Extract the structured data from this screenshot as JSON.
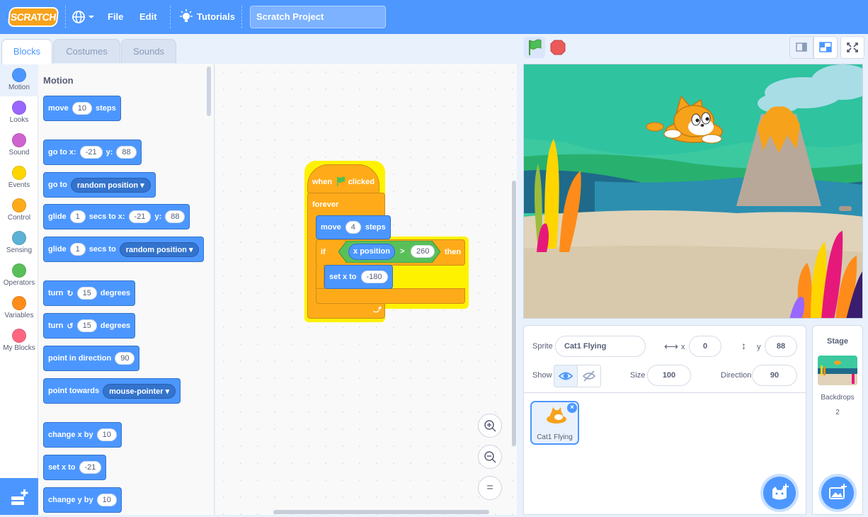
{
  "menubar": {
    "logo": "SCRATCH",
    "file": "File",
    "edit": "Edit",
    "tutorials": "Tutorials",
    "project_title": "Scratch Project"
  },
  "tabs": {
    "code": "Blocks",
    "costumes": "Costumes",
    "sounds": "Sounds"
  },
  "categories": [
    {
      "label": "Motion",
      "color": "#4c97ff"
    },
    {
      "label": "Looks",
      "color": "#9966ff"
    },
    {
      "label": "Sound",
      "color": "#cf63cf"
    },
    {
      "label": "Events",
      "color": "#ffd500"
    },
    {
      "label": "Control",
      "color": "#ffab19"
    },
    {
      "label": "Sensing",
      "color": "#5cb1d6"
    },
    {
      "label": "Operators",
      "color": "#59c059"
    },
    {
      "label": "Variables",
      "color": "#ff8c1a"
    },
    {
      "label": "My Blocks",
      "color": "#ff6680"
    }
  ],
  "palette": {
    "title": "Motion",
    "move": {
      "a": "move",
      "v": "10",
      "b": "steps"
    },
    "goto_xy": {
      "a": "go to x:",
      "x": "-21",
      "b": "y:",
      "y": "88"
    },
    "goto": {
      "a": "go to",
      "d": "random position"
    },
    "glide_xy": {
      "a": "glide",
      "v": "1",
      "b": "secs to x:",
      "x": "-21",
      "c": "y:",
      "y": "88"
    },
    "glide": {
      "a": "glide",
      "v": "1",
      "b": "secs to",
      "d": "random position"
    },
    "turn_right": {
      "a": "turn",
      "v": "15",
      "b": "degrees"
    },
    "turn_left": {
      "a": "turn",
      "v": "15",
      "b": "degrees"
    },
    "point_dir": {
      "a": "point in direction",
      "v": "90"
    },
    "point_towards": {
      "a": "point towards",
      "d": "mouse-pointer"
    },
    "change_x": {
      "a": "change x by",
      "v": "10"
    },
    "set_x": {
      "a": "set x to",
      "v": "-21"
    },
    "change_y": {
      "a": "change y by",
      "v": "10"
    }
  },
  "script": {
    "hat_a": "when",
    "hat_b": "clicked",
    "forever": "forever",
    "move_a": "move",
    "move_v": "4",
    "move_b": "steps",
    "if": "if",
    "then": "then",
    "reporter": "x position",
    "op": ">",
    "compare_v": "260",
    "setx_a": "set x to",
    "setx_v": "-180"
  },
  "zoom": {
    "in": "+",
    "out": "−",
    "reset": "="
  },
  "sprite_info": {
    "sprite_label": "Sprite",
    "sprite_name": "Cat1 Flying",
    "x_label": "x",
    "x_value": "0",
    "y_label": "y",
    "y_value": "88",
    "show_label": "Show",
    "size_label": "Size",
    "size_value": "100",
    "direction_label": "Direction",
    "direction_value": "90"
  },
  "sprite_list": [
    {
      "name": "Cat1 Flying"
    }
  ],
  "stage_pane": {
    "title": "Stage",
    "backdrops_label": "Backdrops",
    "backdrops_count": "2"
  }
}
